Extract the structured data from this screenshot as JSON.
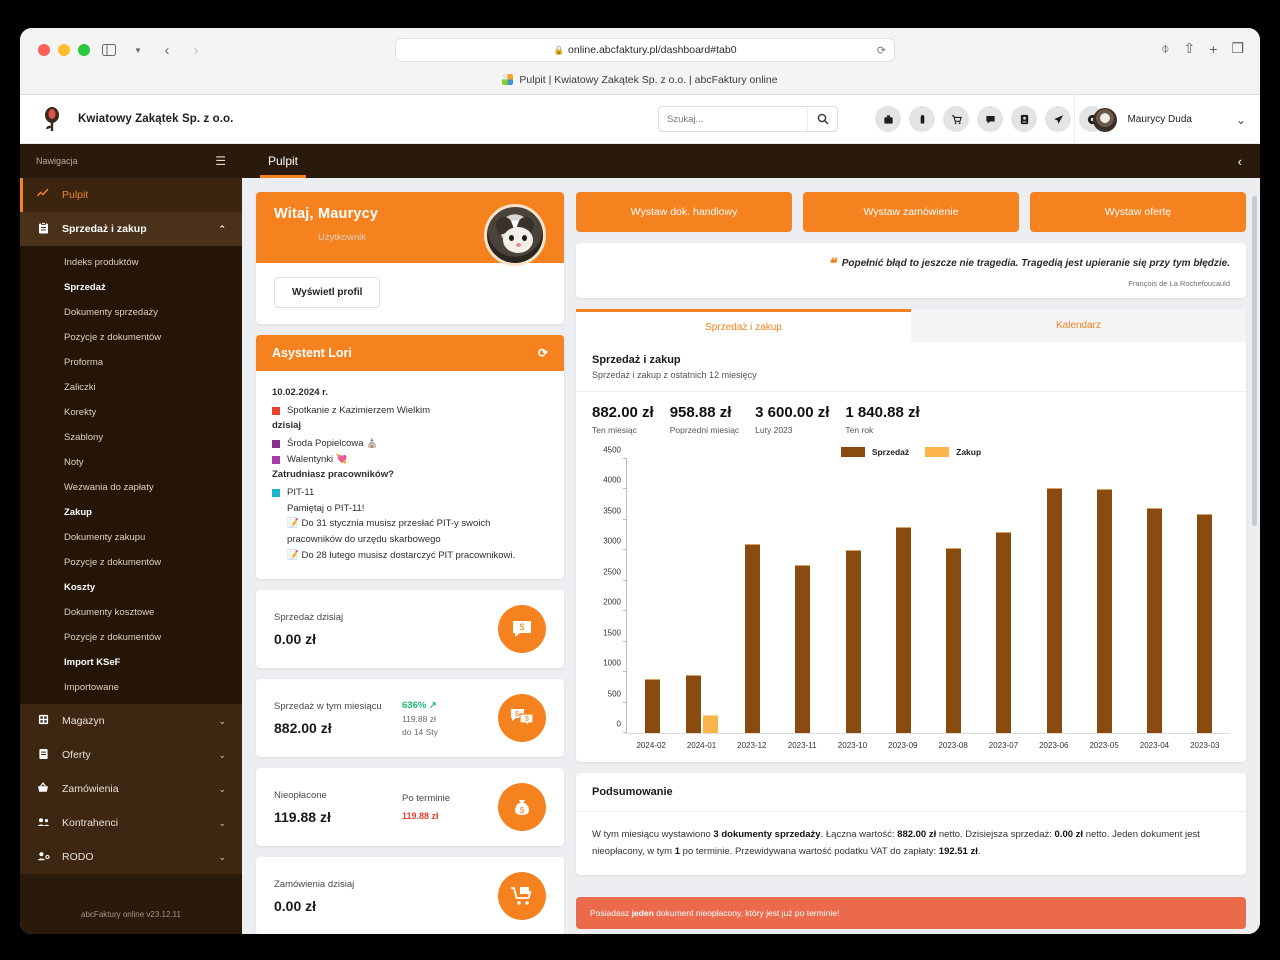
{
  "browser": {
    "url": "online.abcfaktury.pl/dashboard#tab0",
    "lock_icon": "lock-icon",
    "reload_icon": "reload-icon",
    "tab_title": "Pulpit | Kwiatowy Zakątek Sp. z o.o. | abcFaktury online",
    "back_icon": "back-arrow-icon",
    "forward_icon": "forward-arrow-icon",
    "sidebar_icon": "sidebar-toggle-icon",
    "downloads_icon": "downloads-icon",
    "share_icon": "share-icon",
    "newtab_icon": "new-tab-icon",
    "tabs_icon": "tab-overview-icon"
  },
  "appheader": {
    "company": "Kwiatowy Zakątek Sp. z o.o.",
    "search_placeholder": "Szukaj...",
    "search_value": "",
    "user_name": "Maurycy Duda",
    "quick_icons": [
      "briefcase-icon",
      "battery-icon",
      "cart-icon",
      "chat-icon",
      "user-badge-icon",
      "send-icon",
      "info-icon"
    ]
  },
  "sidebar": {
    "title": "Nawigacja",
    "burger_icon": "hamburger-icon",
    "version": "abcFaktury online v23.12.11",
    "items": [
      {
        "label": "Pulpit",
        "icon": "chart-line-icon",
        "state": "active"
      },
      {
        "label": "Sprzedaż i zakup",
        "icon": "clipboard-icon",
        "state": "open",
        "chevron": "chevron-up-icon"
      },
      {
        "label": "Magazyn",
        "icon": "warehouse-icon",
        "state": "collapsed",
        "chevron": "chevron-down-icon"
      },
      {
        "label": "Oferty",
        "icon": "document-icon",
        "state": "collapsed",
        "chevron": "chevron-down-icon"
      },
      {
        "label": "Zamówienia",
        "icon": "basket-icon",
        "state": "collapsed",
        "chevron": "chevron-down-icon"
      },
      {
        "label": "Kontrahenci",
        "icon": "people-icon",
        "state": "collapsed",
        "chevron": "chevron-down-icon"
      },
      {
        "label": "RODO",
        "icon": "user-lock-icon",
        "state": "collapsed",
        "chevron": "chevron-down-icon"
      }
    ],
    "submenu": [
      {
        "label": "Indeks produktów",
        "bold": false
      },
      {
        "label": "Sprzedaż",
        "bold": true
      },
      {
        "label": "Dokumenty sprzedaży",
        "bold": false
      },
      {
        "label": "Pozycje z dokumentów",
        "bold": false
      },
      {
        "label": "Proforma",
        "bold": false
      },
      {
        "label": "Zaliczki",
        "bold": false
      },
      {
        "label": "Korekty",
        "bold": false
      },
      {
        "label": "Szablony",
        "bold": false
      },
      {
        "label": "Noty",
        "bold": false
      },
      {
        "label": "Wezwania do zapłaty",
        "bold": false
      },
      {
        "label": "Zakup",
        "bold": true
      },
      {
        "label": "Dokumenty zakupu",
        "bold": false
      },
      {
        "label": "Pozycje z dokumentów",
        "bold": false
      },
      {
        "label": "Koszty",
        "bold": true
      },
      {
        "label": "Dokumenty kosztowe",
        "bold": false
      },
      {
        "label": "Pozycje z dokumentów",
        "bold": false
      },
      {
        "label": "Import KSeF",
        "bold": true
      },
      {
        "label": "Importowane",
        "bold": false
      }
    ]
  },
  "topbar": {
    "tab_label": "Pulpit",
    "collapse_icon": "chevron-left-icon"
  },
  "welcome": {
    "greeting": "Witaj, Maurycy",
    "role": "Użytkownik",
    "profile_button": "Wyświetl profil"
  },
  "assistant": {
    "title": "Asystent Lori",
    "refresh_icon": "refresh-icon",
    "date": "10.02.2024 r.",
    "events": [
      {
        "text": "Spotkanie z Kazimierzem Wielkim",
        "color": "#e8402a"
      }
    ],
    "today_label": "dzisiaj",
    "today_events": [
      {
        "text": "Środa Popielcowa ⛪",
        "color": "#8b2f8b"
      },
      {
        "text": "Walentynki 💘",
        "color": "#a93ca9"
      }
    ],
    "question": "Zatrudniasz pracowników?",
    "tag": {
      "text": "PIT-11",
      "color": "#19b6c9"
    },
    "remember": "Pamiętaj o PIT-11!",
    "notes": [
      "📝 Do 31 stycznia musisz przesłać PIT-y swoich pracowników do urzędu skarbowego",
      "📝 Do 28 lutego musisz dostarczyć PIT pracownikowi."
    ]
  },
  "stats": [
    {
      "label": "Sprzedaż dzisiaj",
      "value": "0.00 zł",
      "icon": "chat-money-icon",
      "mid_label": "",
      "mid_pct": "",
      "mid_sub": "",
      "mid_sub2": "",
      "mid_red": ""
    },
    {
      "label": "Sprzedaż w tym miesiącu",
      "value": "882.00 zł",
      "icon": "chats-money-icon",
      "mid_label": "",
      "mid_pct": "636% ↗",
      "mid_sub": "119.88 zł",
      "mid_sub2": "do 14 Sty",
      "mid_red": ""
    },
    {
      "label": "Nieopłacone",
      "value": "119.88 zł",
      "icon": "money-bag-icon",
      "mid_label": "Po terminie",
      "mid_pct": "",
      "mid_sub": "",
      "mid_sub2": "",
      "mid_red": "119.88 zł"
    },
    {
      "label": "Zamówienia dzisiaj",
      "value": "0.00 zł",
      "icon": "cart-box-icon",
      "mid_label": "",
      "mid_pct": "",
      "mid_sub": "",
      "mid_sub2": "",
      "mid_red": ""
    }
  ],
  "actions": [
    {
      "label": "Wystaw dok. handlowy"
    },
    {
      "label": "Wystaw zamówienie"
    },
    {
      "label": "Wystaw ofertę"
    }
  ],
  "quote": {
    "mark": "❝",
    "text": "Popełnić błąd to jeszcze nie tragedia. Tragedią jest upieranie się przy tym błędzie.",
    "author": "François de La Rochefoucauld"
  },
  "tabs": [
    {
      "label": "Sprzedaż i zakup",
      "active": true
    },
    {
      "label": "Kalendarz",
      "active": false
    }
  ],
  "kpis": [
    {
      "value": "882.00 zł",
      "label": "Ten miesiąc"
    },
    {
      "value": "958.88 zł",
      "label": "Poprzedni miesiąc"
    },
    {
      "value": "3 600.00 zł",
      "label": "Luty 2023"
    },
    {
      "value": "1 840.88 zł",
      "label": "Ten rok"
    }
  ],
  "chart_data": {
    "type": "bar",
    "title": "Sprzedaż i zakup",
    "subtitle": "Sprzedaż i zakup z ostatnich 12 miesięcy",
    "xlabel": "",
    "ylabel": "",
    "ylim": [
      0,
      4500
    ],
    "yticks": [
      0,
      500,
      1000,
      1500,
      2000,
      2500,
      3000,
      3500,
      4000,
      4500
    ],
    "grid": false,
    "legend_position": "top-right",
    "categories": [
      "2024-02",
      "2024-01",
      "2023-12",
      "2023-11",
      "2023-10",
      "2023-09",
      "2023-08",
      "2023-07",
      "2023-06",
      "2023-05",
      "2023-04",
      "2023-03"
    ],
    "series": [
      {
        "name": "Sprzedaż",
        "color": "#8a4b10",
        "values": [
          882,
          959,
          3100,
          2760,
          3000,
          3380,
          3040,
          3300,
          4030,
          4010,
          3690,
          3600
        ]
      },
      {
        "name": "Zakup",
        "color": "#fbb44c",
        "values": [
          0,
          300,
          0,
          0,
          0,
          0,
          0,
          0,
          0,
          0,
          0,
          0
        ]
      }
    ]
  },
  "summary": {
    "title": "Podsumowanie",
    "line1_a": "W tym miesiącu wystawiono ",
    "line1_b": "3 dokumenty sprzedaży",
    "line1_c": ". Łączna wartość: ",
    "line1_d": "882.00 zł",
    "line1_e": " netto. Dzisiejsza sprzedaż: ",
    "line1_f": "0.00 zł",
    "line1_g": " netto. Jeden dokument jest nieopłacony, w tym ",
    "line1_h": "1",
    "line1_i": " po terminie. Przewidywana wartość podatku VAT do zapłaty: ",
    "line1_j": "192.51 zł",
    "line1_k": ".",
    "alert_a": "Posiadasz ",
    "alert_b": "jeden",
    "alert_c": " dokument nieopłacony, który jest już po terminie!"
  }
}
